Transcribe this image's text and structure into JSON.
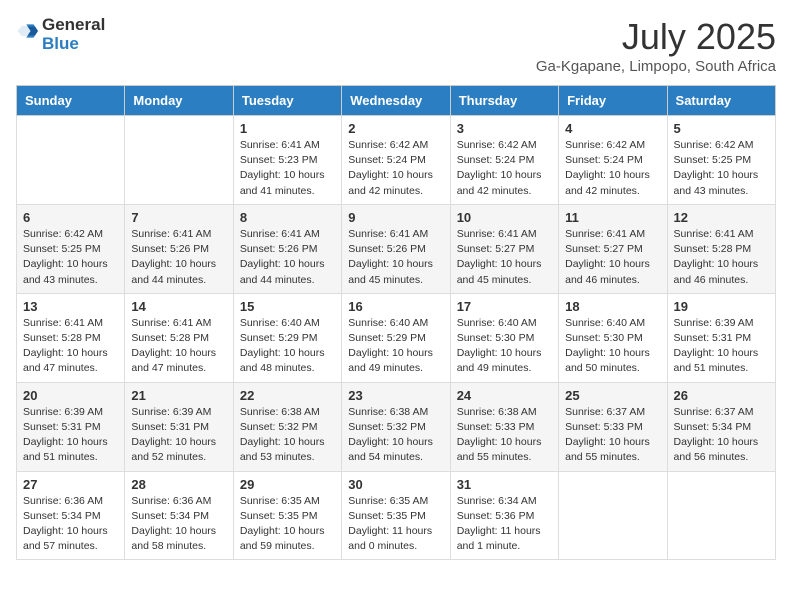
{
  "header": {
    "logo_general": "General",
    "logo_blue": "Blue",
    "title": "July 2025",
    "subtitle": "Ga-Kgapane, Limpopo, South Africa"
  },
  "columns": [
    "Sunday",
    "Monday",
    "Tuesday",
    "Wednesday",
    "Thursday",
    "Friday",
    "Saturday"
  ],
  "weeks": [
    [
      {
        "day": "",
        "info": ""
      },
      {
        "day": "",
        "info": ""
      },
      {
        "day": "1",
        "info": "Sunrise: 6:41 AM\nSunset: 5:23 PM\nDaylight: 10 hours and 41 minutes."
      },
      {
        "day": "2",
        "info": "Sunrise: 6:42 AM\nSunset: 5:24 PM\nDaylight: 10 hours and 42 minutes."
      },
      {
        "day": "3",
        "info": "Sunrise: 6:42 AM\nSunset: 5:24 PM\nDaylight: 10 hours and 42 minutes."
      },
      {
        "day": "4",
        "info": "Sunrise: 6:42 AM\nSunset: 5:24 PM\nDaylight: 10 hours and 42 minutes."
      },
      {
        "day": "5",
        "info": "Sunrise: 6:42 AM\nSunset: 5:25 PM\nDaylight: 10 hours and 43 minutes."
      }
    ],
    [
      {
        "day": "6",
        "info": "Sunrise: 6:42 AM\nSunset: 5:25 PM\nDaylight: 10 hours and 43 minutes."
      },
      {
        "day": "7",
        "info": "Sunrise: 6:41 AM\nSunset: 5:26 PM\nDaylight: 10 hours and 44 minutes."
      },
      {
        "day": "8",
        "info": "Sunrise: 6:41 AM\nSunset: 5:26 PM\nDaylight: 10 hours and 44 minutes."
      },
      {
        "day": "9",
        "info": "Sunrise: 6:41 AM\nSunset: 5:26 PM\nDaylight: 10 hours and 45 minutes."
      },
      {
        "day": "10",
        "info": "Sunrise: 6:41 AM\nSunset: 5:27 PM\nDaylight: 10 hours and 45 minutes."
      },
      {
        "day": "11",
        "info": "Sunrise: 6:41 AM\nSunset: 5:27 PM\nDaylight: 10 hours and 46 minutes."
      },
      {
        "day": "12",
        "info": "Sunrise: 6:41 AM\nSunset: 5:28 PM\nDaylight: 10 hours and 46 minutes."
      }
    ],
    [
      {
        "day": "13",
        "info": "Sunrise: 6:41 AM\nSunset: 5:28 PM\nDaylight: 10 hours and 47 minutes."
      },
      {
        "day": "14",
        "info": "Sunrise: 6:41 AM\nSunset: 5:28 PM\nDaylight: 10 hours and 47 minutes."
      },
      {
        "day": "15",
        "info": "Sunrise: 6:40 AM\nSunset: 5:29 PM\nDaylight: 10 hours and 48 minutes."
      },
      {
        "day": "16",
        "info": "Sunrise: 6:40 AM\nSunset: 5:29 PM\nDaylight: 10 hours and 49 minutes."
      },
      {
        "day": "17",
        "info": "Sunrise: 6:40 AM\nSunset: 5:30 PM\nDaylight: 10 hours and 49 minutes."
      },
      {
        "day": "18",
        "info": "Sunrise: 6:40 AM\nSunset: 5:30 PM\nDaylight: 10 hours and 50 minutes."
      },
      {
        "day": "19",
        "info": "Sunrise: 6:39 AM\nSunset: 5:31 PM\nDaylight: 10 hours and 51 minutes."
      }
    ],
    [
      {
        "day": "20",
        "info": "Sunrise: 6:39 AM\nSunset: 5:31 PM\nDaylight: 10 hours and 51 minutes."
      },
      {
        "day": "21",
        "info": "Sunrise: 6:39 AM\nSunset: 5:31 PM\nDaylight: 10 hours and 52 minutes."
      },
      {
        "day": "22",
        "info": "Sunrise: 6:38 AM\nSunset: 5:32 PM\nDaylight: 10 hours and 53 minutes."
      },
      {
        "day": "23",
        "info": "Sunrise: 6:38 AM\nSunset: 5:32 PM\nDaylight: 10 hours and 54 minutes."
      },
      {
        "day": "24",
        "info": "Sunrise: 6:38 AM\nSunset: 5:33 PM\nDaylight: 10 hours and 55 minutes."
      },
      {
        "day": "25",
        "info": "Sunrise: 6:37 AM\nSunset: 5:33 PM\nDaylight: 10 hours and 55 minutes."
      },
      {
        "day": "26",
        "info": "Sunrise: 6:37 AM\nSunset: 5:34 PM\nDaylight: 10 hours and 56 minutes."
      }
    ],
    [
      {
        "day": "27",
        "info": "Sunrise: 6:36 AM\nSunset: 5:34 PM\nDaylight: 10 hours and 57 minutes."
      },
      {
        "day": "28",
        "info": "Sunrise: 6:36 AM\nSunset: 5:34 PM\nDaylight: 10 hours and 58 minutes."
      },
      {
        "day": "29",
        "info": "Sunrise: 6:35 AM\nSunset: 5:35 PM\nDaylight: 10 hours and 59 minutes."
      },
      {
        "day": "30",
        "info": "Sunrise: 6:35 AM\nSunset: 5:35 PM\nDaylight: 11 hours and 0 minutes."
      },
      {
        "day": "31",
        "info": "Sunrise: 6:34 AM\nSunset: 5:36 PM\nDaylight: 11 hours and 1 minute."
      },
      {
        "day": "",
        "info": ""
      },
      {
        "day": "",
        "info": ""
      }
    ]
  ]
}
